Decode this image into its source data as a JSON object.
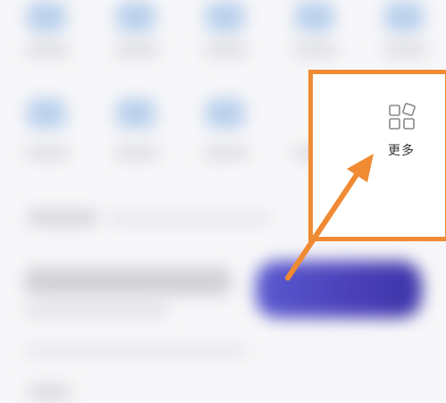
{
  "more_item": {
    "label": "更多",
    "icon": "apps-grid-icon"
  },
  "colors": {
    "highlight": "#f08a33",
    "card_accent": "#4a3fb8"
  }
}
